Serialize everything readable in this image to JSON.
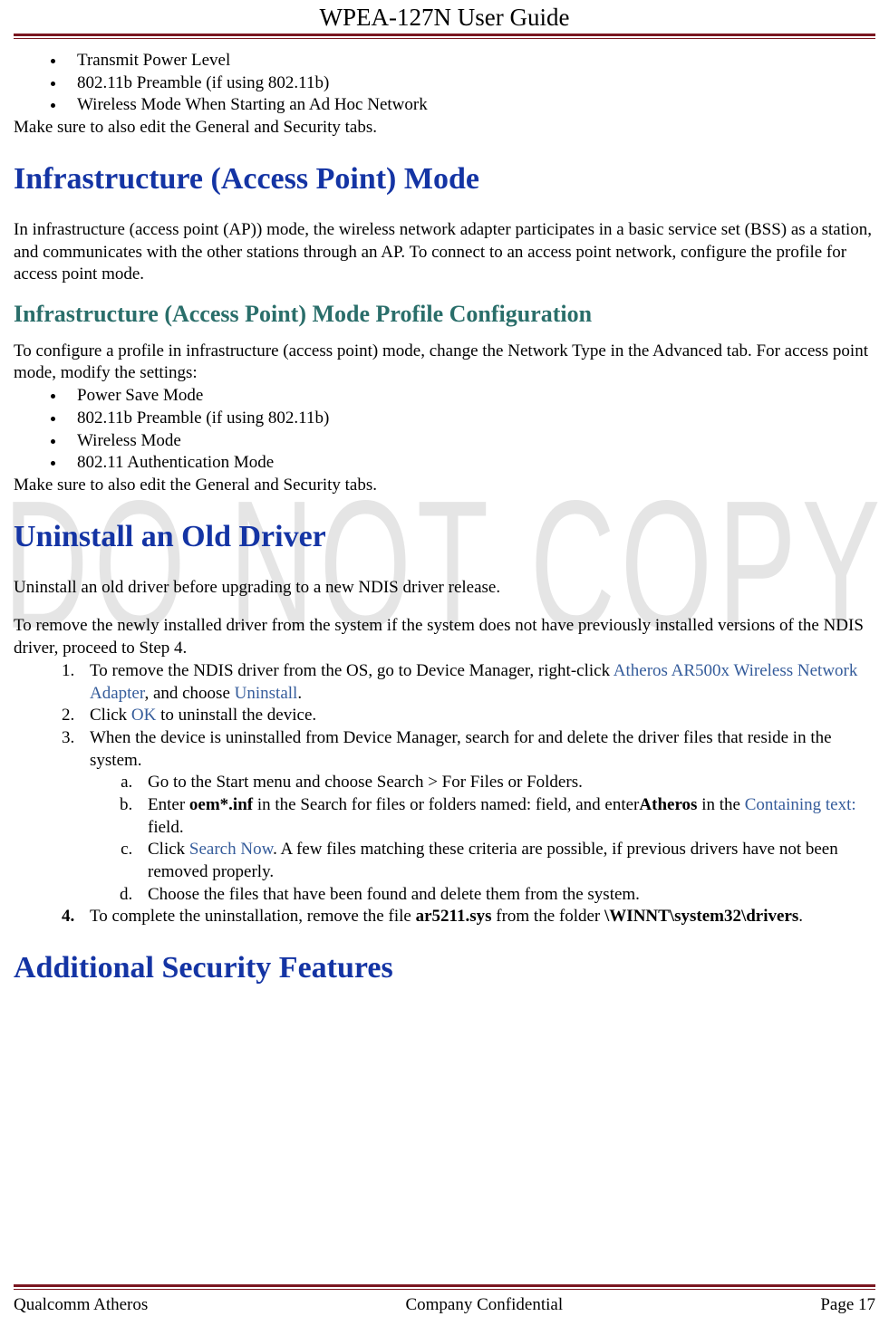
{
  "header": {
    "title": "WPEA-127N User Guide"
  },
  "watermark": "DO NOT COPY",
  "intro_bullets": [
    "Transmit Power Level",
    "802.11b Preamble (if using 802.11b)",
    "Wireless Mode When Starting an Ad Hoc Network"
  ],
  "intro_tail": "Make sure to also edit the General and Security tabs.",
  "h1_infra": "Infrastructure (Access Point) Mode",
  "infra_para": "In infrastructure (access point (AP)) mode, the wireless network adapter participates in a basic service set (BSS) as a station, and communicates with the other stations through an AP. To connect to an access point network, configure the profile for access point mode.",
  "h2_infra_cfg": "Infrastructure (Access Point) Mode Profile Configuration",
  "infra_cfg_para": "To configure a profile in infrastructure (access point) mode, change the Network Type in the Advanced tab. For access point mode, modify the settings:",
  "infra_cfg_bullets": [
    "Power Save Mode",
    "802.11b Preamble (if using 802.11b)",
    "Wireless Mode",
    "802.11 Authentication Mode"
  ],
  "infra_cfg_tail": "Make sure to also edit the General and Security tabs.",
  "h1_uninstall": "Uninstall an Old Driver",
  "uninstall_p1": "Uninstall an old driver before upgrading to a new NDIS driver release.",
  "uninstall_p2": "To remove the newly installed driver from the system if the system does not have previously installed versions of the NDIS driver, proceed to Step 4.",
  "step1": {
    "pre": "To remove the NDIS driver from the OS, go to Device Manager, right-click ",
    "link1": "Atheros AR500x Wireless Network Adapter",
    "mid": ", and choose ",
    "link2": "Uninstall",
    "post": "."
  },
  "step2": {
    "pre": "Click ",
    "link": "OK",
    "post": " to uninstall the device."
  },
  "step3_intro": "When the device is uninstalled from Device Manager, search for and delete the driver files that reside in the system.",
  "step3a": "Go to the Start menu and choose Search > For Files or Folders.",
  "step3b": {
    "pre": "Enter ",
    "bold1": "oem*.inf",
    "mid1": " in the Search for files or folders named: field, and enter",
    "bold2": "Atheros",
    "mid2": " in the ",
    "link": "Containing text:",
    "post": " field."
  },
  "step3c": {
    "pre": "Click ",
    "link": "Search Now",
    "post": ". A few files matching these criteria are possible, if previous drivers have not been removed properly."
  },
  "step3d": "Choose the files that have been found and delete them from the system.",
  "step4": {
    "pre": "To complete the uninstallation, remove the file ",
    "bold1": "ar5211.sys",
    "mid": " from the folder ",
    "bold2": "\\WINNT\\system32\\drivers",
    "post": "."
  },
  "h1_addsec": "Additional Security Features",
  "footer": {
    "left": "Qualcomm Atheros",
    "center": "Company Confidential",
    "right": "Page 17"
  }
}
